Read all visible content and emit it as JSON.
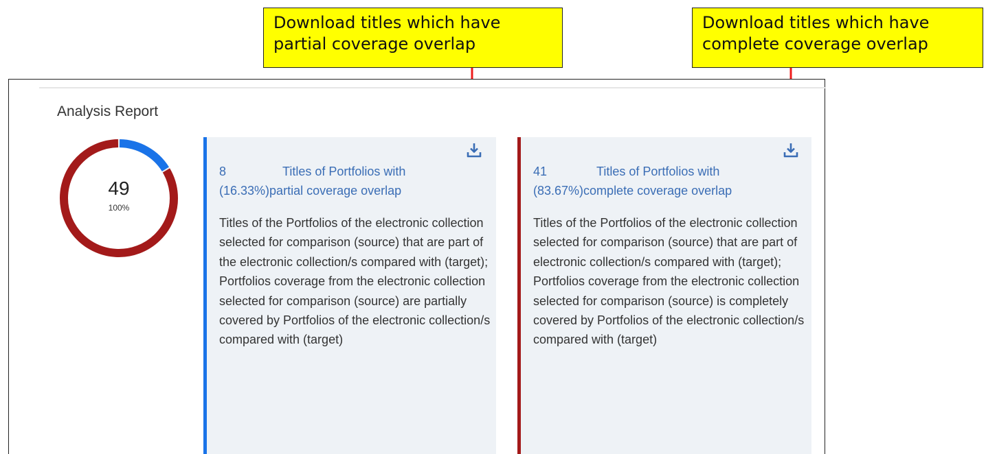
{
  "callouts": {
    "partial": "Download titles which have partial coverage overlap",
    "complete": "Download titles which have complete coverage overlap"
  },
  "report": {
    "title": "Analysis Report",
    "total": "49",
    "total_percent": "100%",
    "chart": {
      "type": "donut",
      "segments": [
        {
          "name": "partial coverage overlap",
          "value": 8,
          "color": "#1a73e8"
        },
        {
          "name": "complete coverage overlap",
          "value": 41,
          "color": "#a31a1a"
        }
      ],
      "track_color": "#eeeeee"
    }
  },
  "cards": {
    "partial": {
      "count": "8",
      "label_line1": "Titles of Portfolios with",
      "percent": "(16.33%)",
      "label_line2": "partial coverage overlap",
      "description": "Titles of the Portfolios of the electronic collection selected for comparison (source) that are part of the electronic collection/s compared with (target); Portfolios coverage from the electronic collection selected for comparison (source) are partially covered by Portfolios of the electronic collection/s compared with (target)",
      "accent": "#1a73e8",
      "download_icon": "download-icon"
    },
    "complete": {
      "count": "41",
      "label_line1": "Titles of Portfolios with",
      "percent": "(83.67%)",
      "label_line2": "complete coverage overlap",
      "description": "Titles of the Portfolios of the electronic collection selected for comparison (source) that are part of electronic collection/s compared with (target); Portfolios coverage from the electronic collection selected for comparison (source) is completely covered by Portfolios of the electronic collection/s compared with (target)",
      "accent": "#a31a1a",
      "download_icon": "download-icon"
    }
  }
}
